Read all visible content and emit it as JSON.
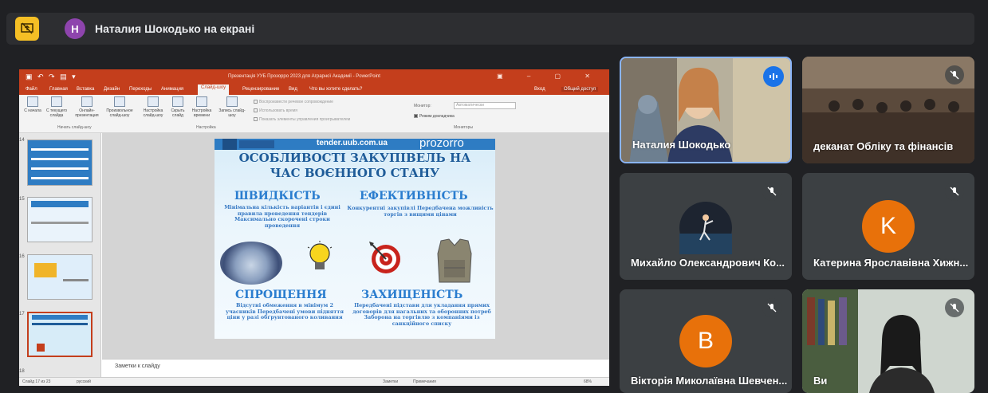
{
  "top_bar": {
    "presenter_initial": "Н",
    "presenter_text": "Наталия Шокодько на екрані",
    "present_icon": "present-to-all-off-icon"
  },
  "powerpoint": {
    "window_caption": "Презентація УУБ Прозорро 2023 для Аграрної Академії - PowerPoint",
    "tabs": [
      "Файл",
      "Главная",
      "Вставка",
      "Дизайн",
      "Переходы",
      "Анимация",
      "Слайд-шоу",
      "Рецензирование",
      "Вид",
      "Что вы хотите сделать?"
    ],
    "active_tab": "Слайд-шоу",
    "signin": "Вход",
    "share": "Общий доступ",
    "ribbon": {
      "from_beginning": "С начала",
      "from_current": "С текущего слайда",
      "online": "Онлайн-презентация",
      "custom": "Произвольное слайд-шоу",
      "setup": "Настройка слайд-шоу",
      "hide": "Скрыть слайд",
      "rehearse": "Настройка времени",
      "record": "Запись слайд-шоу",
      "opt1": "Воспроизвести речевое сопровождение",
      "opt2": "Использовать время",
      "opt3": "Показать элементы управления проигрывателем",
      "monitor_label": "Монитор:",
      "monitor_value": "Автоматически",
      "presenter_view": "Режим докладчика",
      "group1": "Начать слайд-шоу",
      "group2": "Настройка",
      "group3": "Мониторы"
    },
    "thumb_numbers": [
      "14",
      "15",
      "16",
      "17",
      "18"
    ],
    "slide": {
      "url": "tender.uub.com.ua",
      "brand": "prozorro",
      "title_line1": "ОСОБЛИВОСТІ ЗАКУПІВЕЛЬ НА",
      "title_line2": "ЧАС ВОЄННОГО СТАНУ",
      "h1": "ШВИДКІСТЬ",
      "s1": "Мінімальна кількість варіантів і єдині правила проведення тендерів Максимально скорочені строки проведення",
      "h2": "ЕФЕКТИВНІСТЬ",
      "s2": "Конкурентні закупівлі Передбачена можливість торгів з вищими цінами",
      "h3": "СПРОЩЕННЯ",
      "s3": "Відсутні обмеження в мінімум 2 учасників Передбачені умови підняття ціни у разі обґрунтованого коливання",
      "h4": "ЗАХИЩЕНІСТЬ",
      "s4": "Передбачені підстави для укладання прямих договорів для нагальних та оборонних потреб Заборона на торгівлю з компаніями із санкційного списку"
    },
    "notes_placeholder": "Заметки к слайду",
    "status": {
      "slide_count": "Слайд 17 из 23",
      "language": "русский",
      "notes": "Заметки",
      "comments": "Примечания",
      "zoom": "68%"
    }
  },
  "participants": [
    {
      "name": "Наталия Шокодько",
      "speaking": true
    },
    {
      "name": "деканат Обліку та фінансів",
      "muted": true
    },
    {
      "name": "Михайло Олександрович Ко...",
      "muted": true
    },
    {
      "name": "Катерина Ярославівна Хижн...",
      "initial": "K",
      "color": "#e8710a",
      "muted": true
    },
    {
      "name": "Вікторія Миколаївна Шевчен...",
      "initial": "B",
      "color": "#e8710a",
      "muted": true
    },
    {
      "name": "Ви",
      "muted": true
    }
  ]
}
